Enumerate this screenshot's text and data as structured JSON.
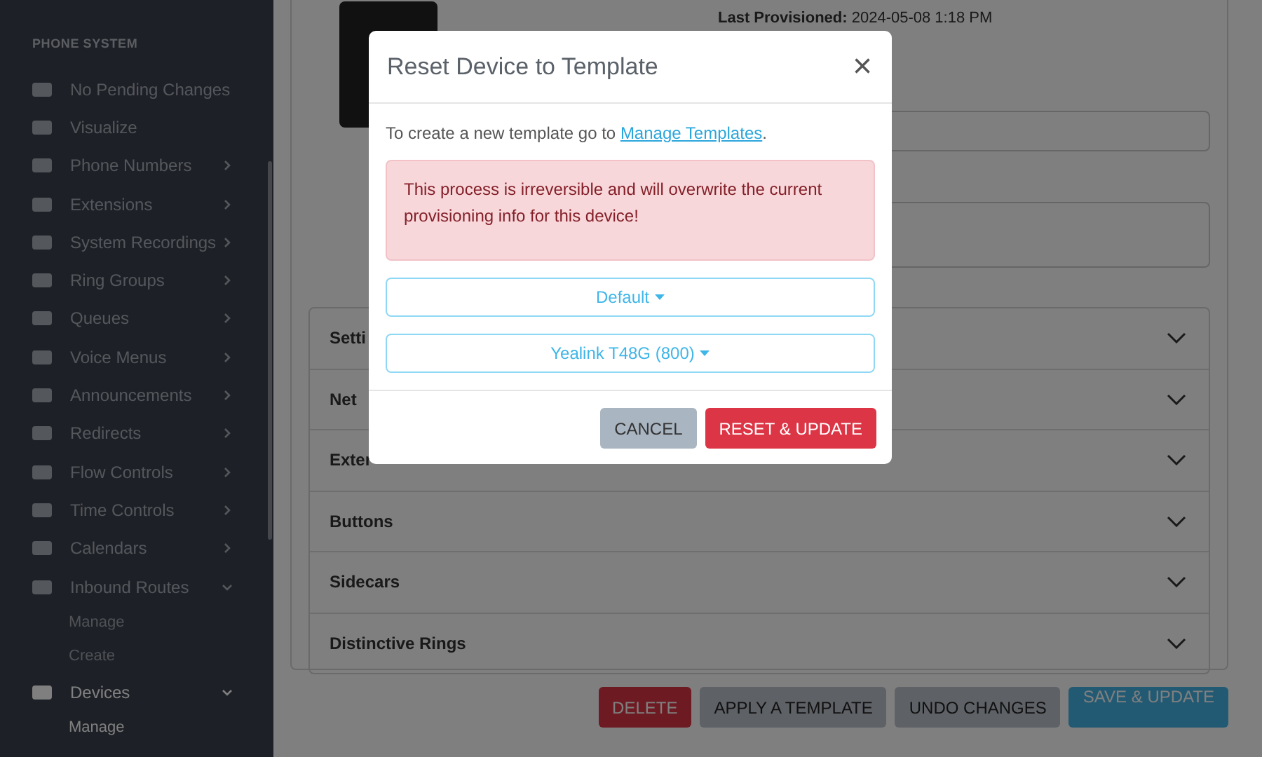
{
  "sidebar": {
    "section_title": "PHONE SYSTEM",
    "items": [
      {
        "label": "No Pending Changes",
        "kind": "link",
        "selected": false
      },
      {
        "label": "Visualize",
        "kind": "link",
        "selected": false
      },
      {
        "label": "Phone Numbers",
        "kind": "group",
        "expanded": false,
        "selected": false
      },
      {
        "label": "Extensions",
        "kind": "group",
        "expanded": false,
        "selected": false
      },
      {
        "label": "System Recordings",
        "kind": "group",
        "expanded": false,
        "selected": false
      },
      {
        "label": "Ring Groups",
        "kind": "group",
        "expanded": false,
        "selected": false
      },
      {
        "label": "Queues",
        "kind": "group",
        "expanded": false,
        "selected": false
      },
      {
        "label": "Voice Menus",
        "kind": "group",
        "expanded": false,
        "selected": false
      },
      {
        "label": "Announcements",
        "kind": "group",
        "expanded": false,
        "selected": false
      },
      {
        "label": "Redirects",
        "kind": "group",
        "expanded": false,
        "selected": false
      },
      {
        "label": "Flow Controls",
        "kind": "group",
        "expanded": false,
        "selected": false
      },
      {
        "label": "Time Controls",
        "kind": "group",
        "expanded": false,
        "selected": false
      },
      {
        "label": "Calendars",
        "kind": "group",
        "expanded": false,
        "selected": false
      },
      {
        "label": "Inbound Routes",
        "kind": "group",
        "expanded": true,
        "selected": false,
        "children": [
          {
            "label": "Manage",
            "selected": false
          },
          {
            "label": "Create",
            "selected": false
          }
        ]
      },
      {
        "label": "Devices",
        "kind": "group",
        "expanded": true,
        "selected": true,
        "children": [
          {
            "label": "Manage",
            "selected": true
          }
        ]
      }
    ]
  },
  "device": {
    "last_provisioned_label": "Last Provisioned:",
    "last_provisioned_value": "2024-05-08 1:18 PM"
  },
  "accordion": [
    {
      "title": "Setti"
    },
    {
      "title": "Net"
    },
    {
      "title": "Exter"
    },
    {
      "title": "Buttons"
    },
    {
      "title": "Sidecars"
    },
    {
      "title": "Distinctive Rings"
    }
  ],
  "actions": [
    {
      "label": "DELETE",
      "kind": "danger"
    },
    {
      "label": "APPLY A TEMPLATE",
      "kind": "secondary"
    },
    {
      "label": "UNDO CHANGES",
      "kind": "secondary"
    },
    {
      "label": "SAVE & UPDATE",
      "kind": "info"
    }
  ],
  "modal": {
    "title": "Reset Device to Template",
    "close": "×",
    "hint_before": "To create a new template go to ",
    "hint_link": "Manage Templates",
    "hint_after": ".",
    "warning": "This process is irreversible and will overwrite the current provisioning info for this device!",
    "dropdowns": [
      {
        "label": "Default"
      },
      {
        "label": "Yealink T48G (800)"
      }
    ],
    "buttons": [
      {
        "label": "CANCEL",
        "kind": "secondary"
      },
      {
        "label": "RESET & UPDATE",
        "kind": "danger"
      }
    ]
  }
}
